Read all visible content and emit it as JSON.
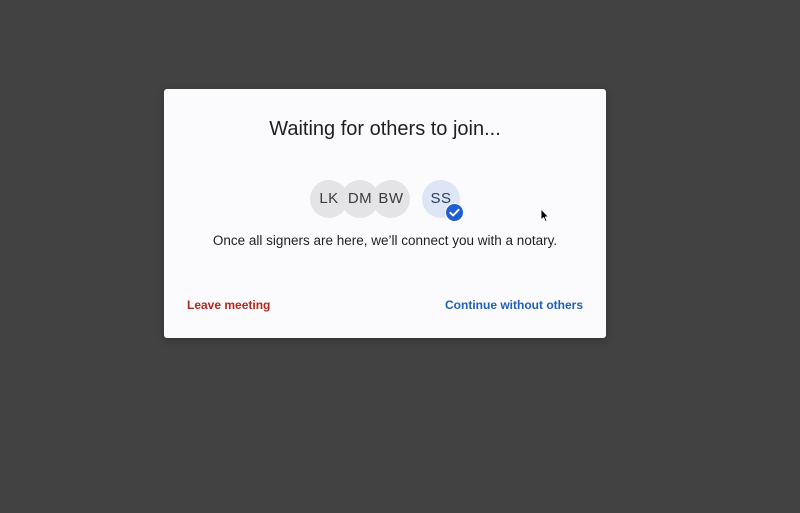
{
  "modal": {
    "title": "Waiting for others to join...",
    "subtitle": "Once all signers are here, we’ll connect you with a notary.",
    "participants": [
      {
        "initials": "LK",
        "joined": false
      },
      {
        "initials": "DM",
        "joined": false
      },
      {
        "initials": "BW",
        "joined": false
      },
      {
        "initials": "SS",
        "joined": true
      }
    ],
    "leave_label": "Leave meeting",
    "continue_label": "Continue without others"
  },
  "colors": {
    "backdrop": "#424242",
    "leave": "#b3261e",
    "continue": "#1f5fb8",
    "check": "#1f5fd1"
  },
  "icons": {
    "joined_badge": "check-icon",
    "pointer": "mouse-cursor-icon"
  }
}
